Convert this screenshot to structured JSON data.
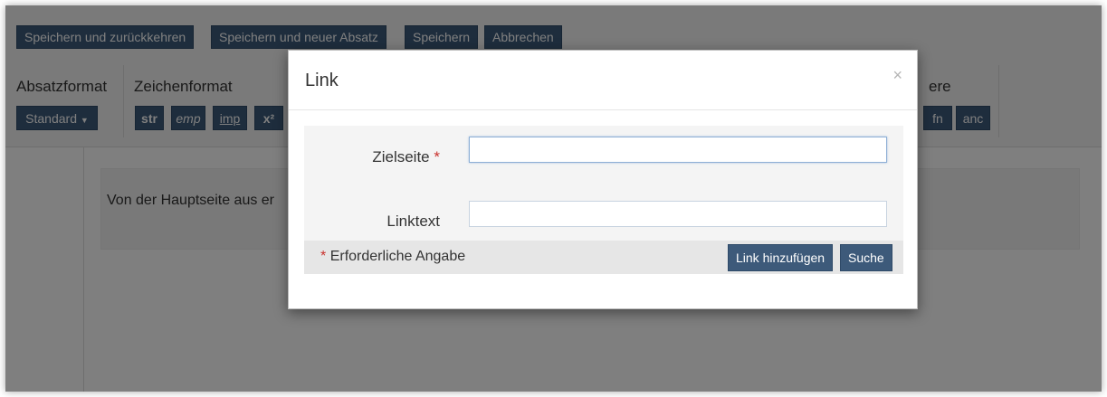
{
  "top_buttons": {
    "save_return": "Speichern und zurückkehren",
    "save_new_paragraph": "Speichern und neuer Absatz",
    "save": "Speichern",
    "cancel": "Abbrechen"
  },
  "toolbar": {
    "paragraph_format_label": "Absatzformat",
    "paragraph_format_value": "Standard",
    "char_format_label": "Zeichenformat",
    "char_buttons": [
      "str",
      "emp",
      "imp",
      "x²"
    ],
    "other_label_partial": "ere",
    "other_buttons": [
      "fn",
      "anc"
    ]
  },
  "editor": {
    "paragraph_text": "Von der Hauptseite aus er"
  },
  "modal": {
    "title": "Link",
    "close": "×",
    "target_label": "Zielseite",
    "required_star": "*",
    "target_value": "",
    "linktext_label": "Linktext",
    "linktext_value": "",
    "required_note": "Erforderliche Angabe",
    "add_link_button": "Link hinzufügen",
    "search_button": "Suche"
  },
  "colors": {
    "button_bg": "#3d5a7a",
    "required": "#c9302c",
    "overlay": "rgba(0,0,0,0.5)"
  }
}
